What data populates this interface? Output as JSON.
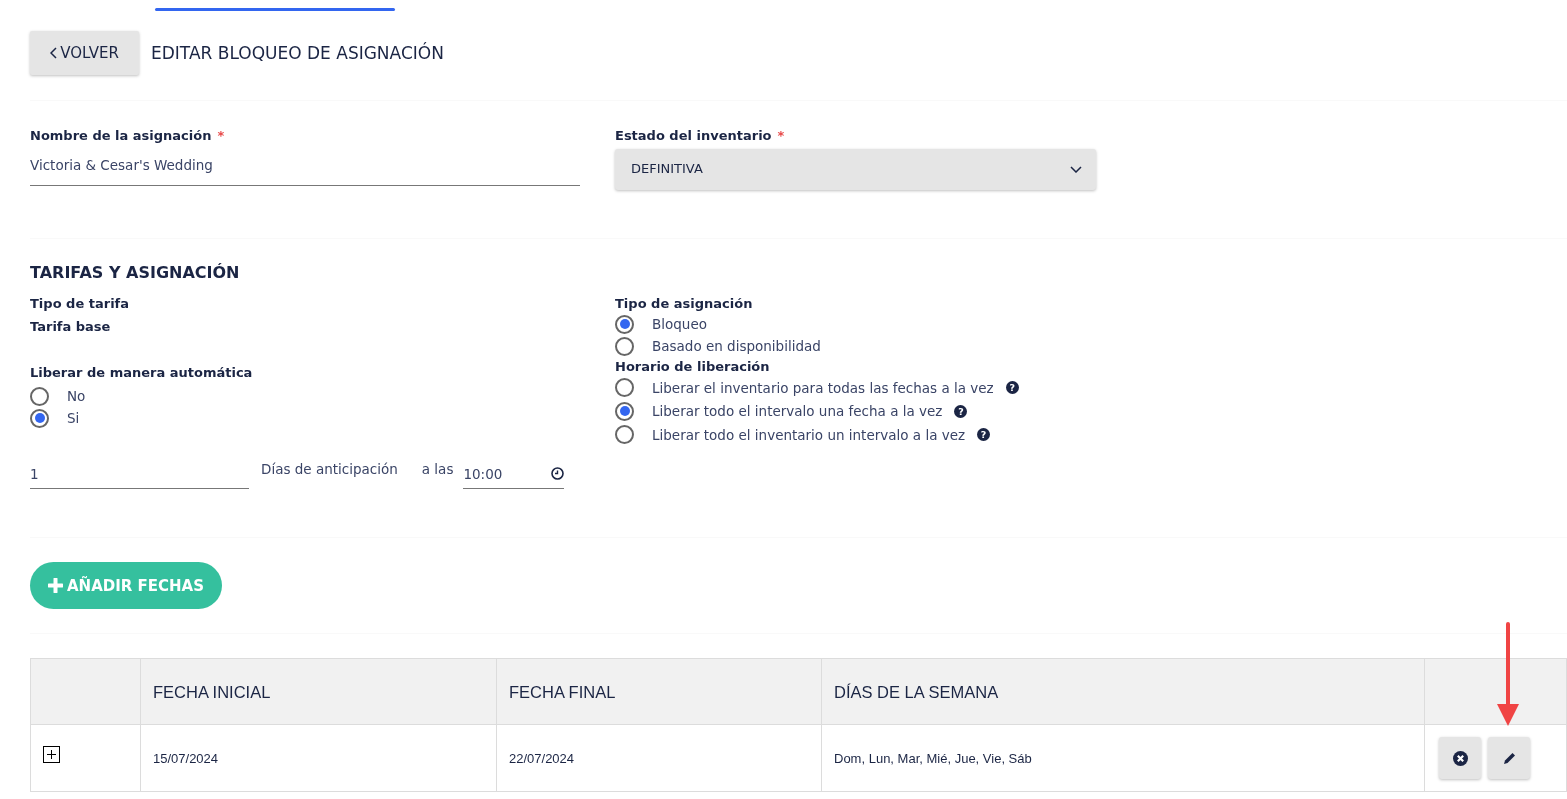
{
  "header": {
    "back_button": "VOLVER",
    "title": "EDITAR BLOQUEO DE ASIGNACIÓN"
  },
  "allocation_name": {
    "label": "Nombre de la asignación",
    "required_mark": "*",
    "value": "Victoria & Cesar's Wedding"
  },
  "inventory_status": {
    "label": "Estado del inventario",
    "required_mark": "*",
    "value": "DEFINITIVA"
  },
  "section_title": "TARIFAS Y ASIGNACIÓN",
  "rate_type": {
    "label": "Tipo de tarifa",
    "value": "Tarifa base"
  },
  "auto_release": {
    "label": "Liberar de manera automática",
    "options": [
      {
        "label": "No",
        "selected": false
      },
      {
        "label": "Si",
        "selected": true
      }
    ]
  },
  "release_fields": {
    "days": "1",
    "days_label": "Días de anticipación",
    "at_label": "a las",
    "time": "10:00"
  },
  "allocation_type": {
    "label": "Tipo de asignación",
    "options": [
      {
        "label": "Bloqueo",
        "selected": true
      },
      {
        "label": "Basado en disponibilidad",
        "selected": false
      }
    ]
  },
  "release_schedule": {
    "label": "Horario de liberación",
    "options": [
      {
        "label": "Liberar el inventario para todas las fechas a la vez",
        "selected": false,
        "help": "?"
      },
      {
        "label": "Liberar todo el intervalo una fecha a la vez",
        "selected": true,
        "help": "?"
      },
      {
        "label": "Liberar todo el inventario un intervalo a la vez",
        "selected": false,
        "help": "?"
      }
    ]
  },
  "add_dates_button": "AÑADIR FECHAS",
  "table": {
    "columns": [
      "FECHA INICIAL",
      "FECHA FINAL",
      "DÍAS DE LA SEMANA"
    ],
    "rows": [
      {
        "expanded": false,
        "cells": [
          "15/07/2024",
          "22/07/2024",
          "Dom, Lun, Mar, Mié, Jue, Vie, Sáb"
        ]
      }
    ]
  }
}
